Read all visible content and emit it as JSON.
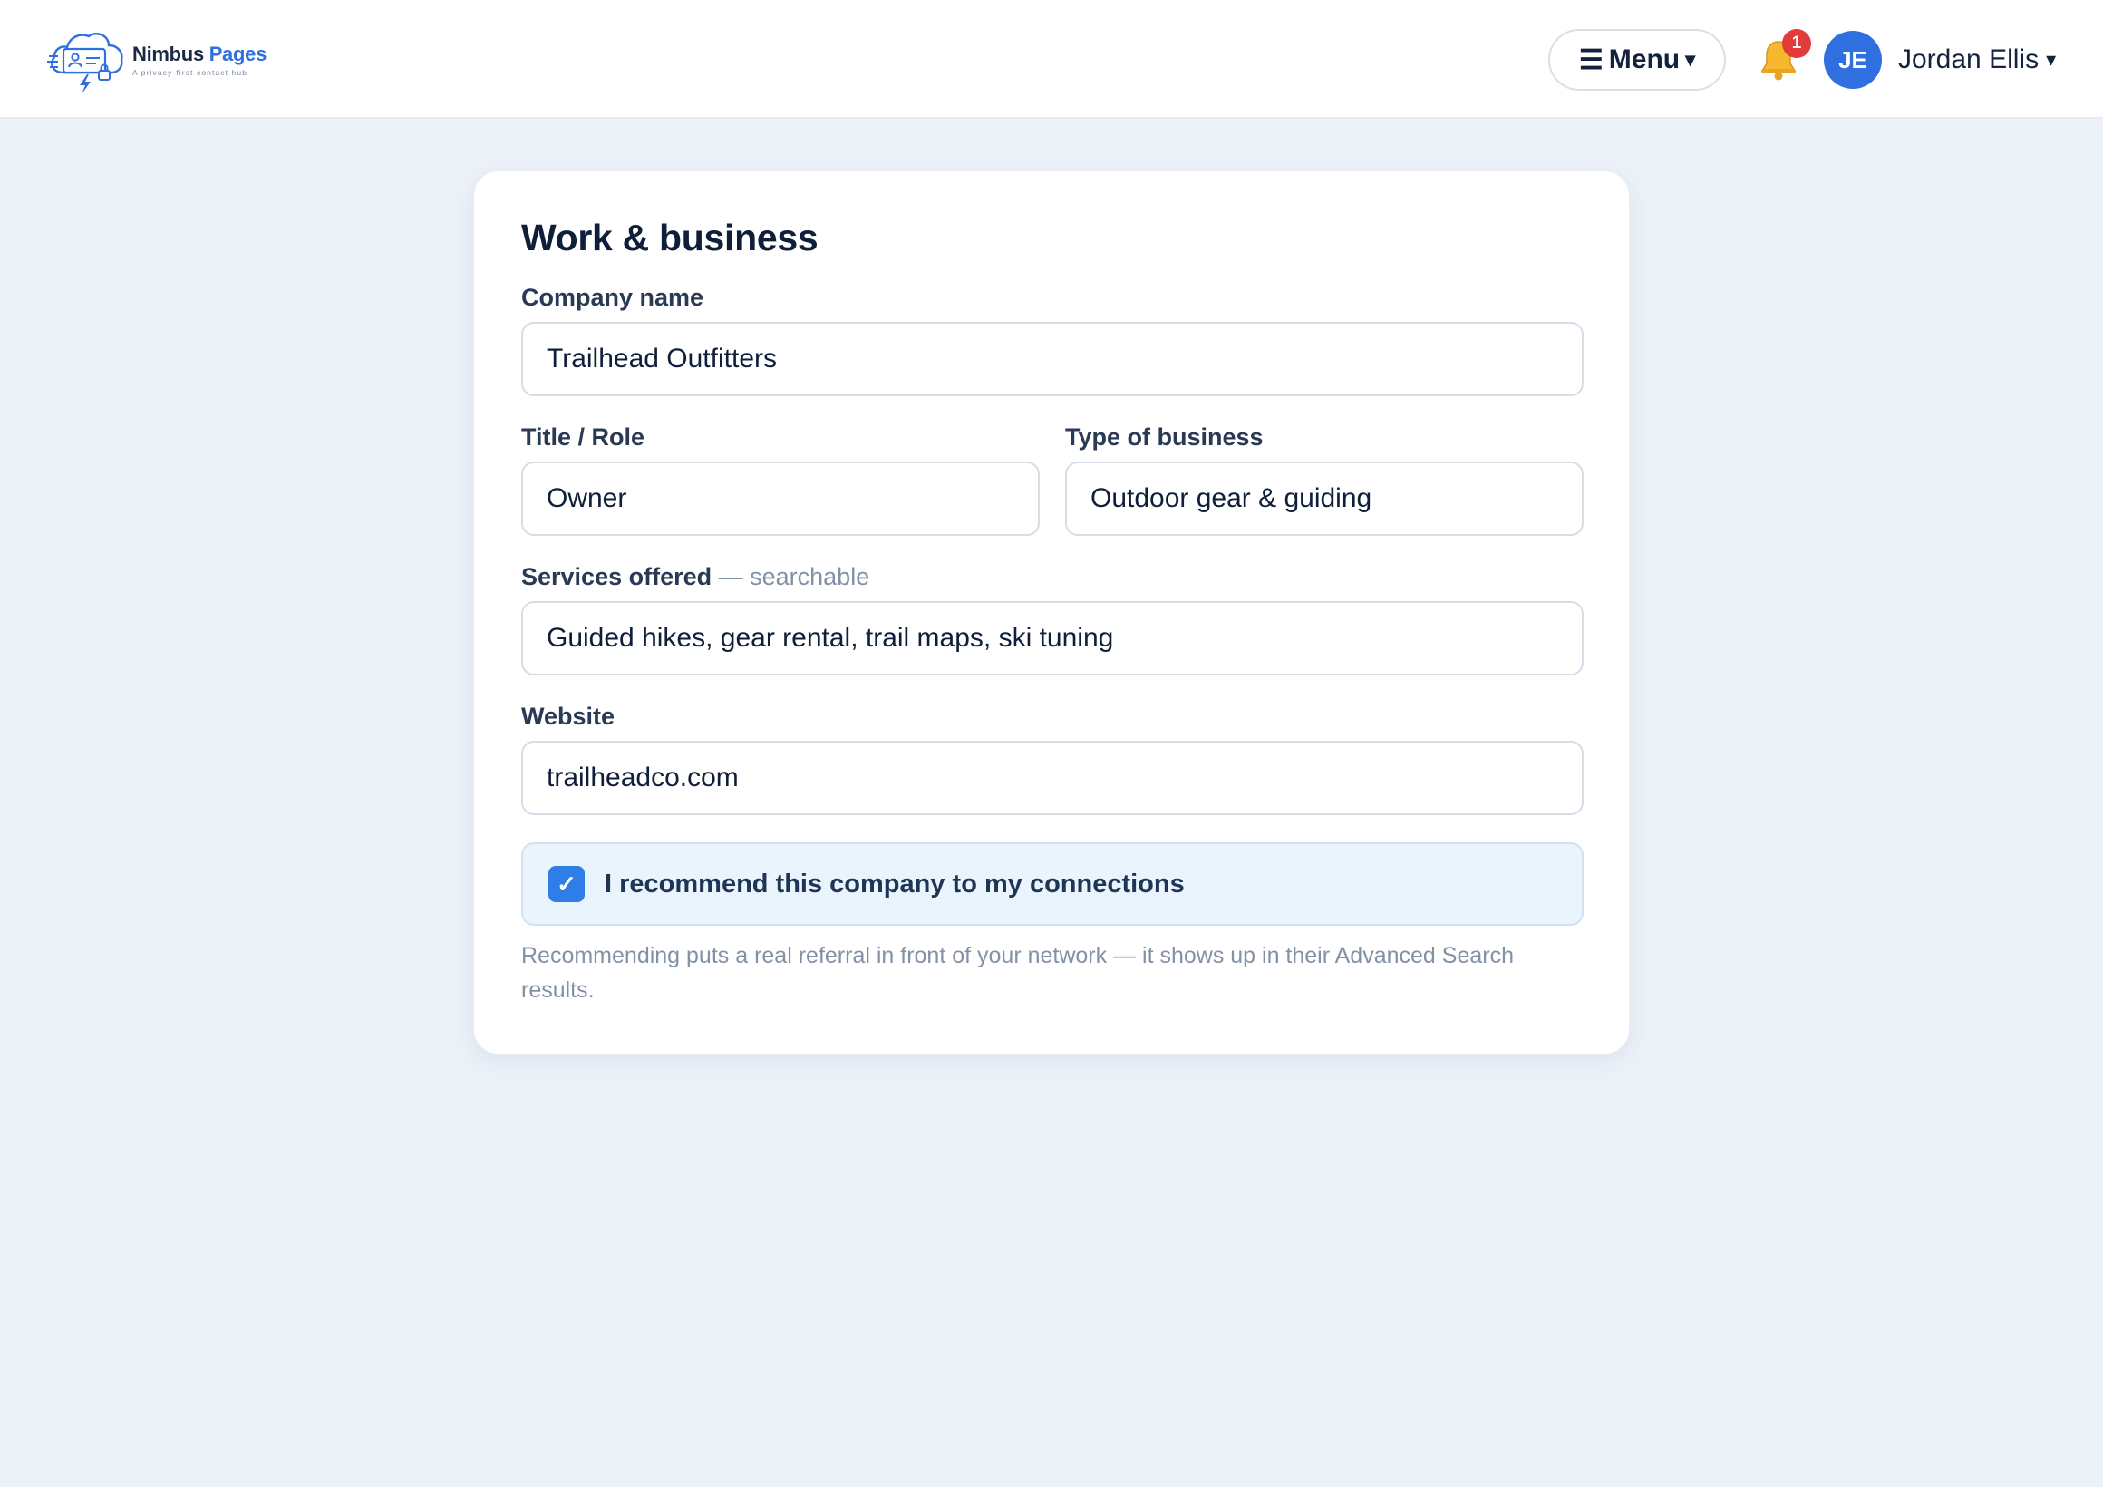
{
  "header": {
    "logo": {
      "name_part1": "Nimbus",
      "name_part2": "Pages",
      "tagline": "A privacy-first contact hub"
    },
    "menu": {
      "icon": "hamburger-icon",
      "label": "Menu",
      "caret": "▾"
    },
    "notifications": {
      "icon": "bell-icon",
      "count": "1"
    },
    "user": {
      "initials": "JE",
      "name": "Jordan Ellis",
      "caret": "▾"
    }
  },
  "form": {
    "title": "Work & business",
    "company": {
      "label": "Company name",
      "value": "Trailhead Outfitters"
    },
    "title_role": {
      "label": "Title / Role",
      "value": "Owner"
    },
    "business_type": {
      "label": "Type of business",
      "value": "Outdoor gear & guiding"
    },
    "services": {
      "label": "Services offered",
      "hint": "— searchable",
      "value": "Guided hikes, gear rental, trail maps, ski tuning"
    },
    "website": {
      "label": "Website",
      "value": "trailheadco.com"
    },
    "recommend": {
      "checked": true,
      "check_glyph": "✓",
      "label": "I recommend this company to my connections"
    },
    "helper": "Recommending puts a real referral in front of your network — it shows up in their Advanced Search results."
  },
  "colors": {
    "accent": "#2f6fe0",
    "badge": "#e33a3a",
    "background": "#edf2f9",
    "check_panel": "#eaf4fd"
  }
}
